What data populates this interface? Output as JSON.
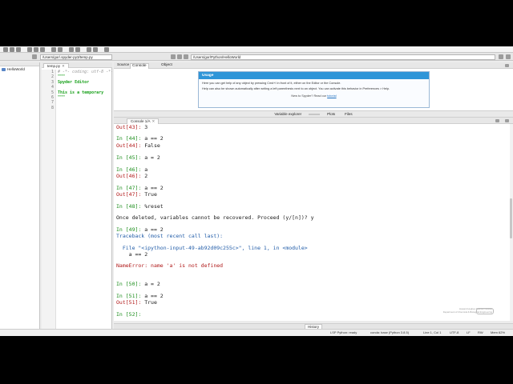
{
  "toolbar": {
    "path_left": "/Users/gor/.spyder-py3/temp.py",
    "path_right": "/Users/gor/Python/HelloWorld"
  },
  "explorer": {
    "item": "HelloWorld"
  },
  "editor": {
    "tab": "temp.py",
    "line_numbers": [
      "1",
      "2",
      "3",
      "4",
      "5",
      "6",
      "7",
      "8"
    ],
    "lines": [
      {
        "text": "# -*- coding: utf-8 -*-",
        "kind": "comment"
      },
      {
        "text": "\"\"\"",
        "kind": "doc"
      },
      {
        "text": "Spyder Editor",
        "kind": "doc"
      },
      {
        "text": "",
        "kind": "doc"
      },
      {
        "text": "This is a temporary",
        "kind": "doc"
      },
      {
        "text": "\"\"\"",
        "kind": "doc"
      },
      {
        "text": "",
        "kind": "doc"
      },
      {
        "text": "",
        "kind": "doc"
      }
    ]
  },
  "right_tabs": [
    "Source",
    "Console",
    "Object"
  ],
  "help": {
    "title": "Usage",
    "line1": "Here you can get help of any object by pressing Cmd+I in front of it, either on the Editor or the Console.",
    "line2": "Help can also be shown automatically after writing a left parenthesis next to an object. You can activate this behavior in Preferences > Help.",
    "footer_prefix": "New to Spyder? Read our",
    "footer_link": "tutorial"
  },
  "var_tabs": [
    "Variable explorer",
    "Plots",
    "Files"
  ],
  "console": {
    "tab": "Console 1/A",
    "lines": [
      {
        "prompt": "Out[43]:",
        "text": " 3",
        "kind": "out"
      },
      {
        "prompt": "In [44]:",
        "text": " a == 2",
        "kind": "in"
      },
      {
        "prompt": "Out[44]:",
        "text": " False",
        "kind": "out"
      },
      {
        "prompt": "In [45]:",
        "text": " a = 2",
        "kind": "in"
      },
      {
        "prompt": "In [46]:",
        "text": " a",
        "kind": "in"
      },
      {
        "prompt": "Out[46]:",
        "text": " 2",
        "kind": "out"
      },
      {
        "prompt": "In [47]:",
        "text": " a == 2",
        "kind": "in"
      },
      {
        "prompt": "Out[47]:",
        "text": " True",
        "kind": "out"
      },
      {
        "prompt": "In [48]:",
        "text": " %reset",
        "kind": "in"
      },
      {
        "prompt": "",
        "text": "Once deleted, variables cannot be recovered. Proceed (y/[n])? y",
        "kind": "plain"
      },
      {
        "prompt": "In [49]:",
        "text": " a == 2",
        "kind": "in"
      },
      {
        "prompt": "",
        "text": "Traceback (most recent call last):",
        "kind": "tb"
      },
      {
        "prompt": "",
        "text": "  File \"<ipython-input-49-ab92d09c255c>\", line 1, in <module>",
        "kind": "file"
      },
      {
        "prompt": "",
        "text": "    a == 2",
        "kind": "plain"
      },
      {
        "prompt": "",
        "text": "NameError: name 'a' is not defined",
        "kind": "err"
      },
      {
        "prompt": "In [50]:",
        "text": " a = 2",
        "kind": "in"
      },
      {
        "prompt": "In [51]:",
        "text": " a == 2",
        "kind": "in"
      },
      {
        "prompt": "Out[51]:",
        "text": " True",
        "kind": "out"
      },
      {
        "prompt": "In [52]:",
        "text": "",
        "kind": "in"
      }
    ]
  },
  "watermark": {
    "line1": "Howard Hughes Medical Institute",
    "line2": "Department of Chemical & Biological Engineering"
  },
  "history_tab": "History",
  "status": {
    "lsp": "LSP Python: ready",
    "conda": "conda: base (Python 3.8.5)",
    "position": "Line 1, Col 1",
    "encoding": "UTF-8",
    "eol": "LF",
    "perm": "RW",
    "mem": "Mem 62%"
  }
}
